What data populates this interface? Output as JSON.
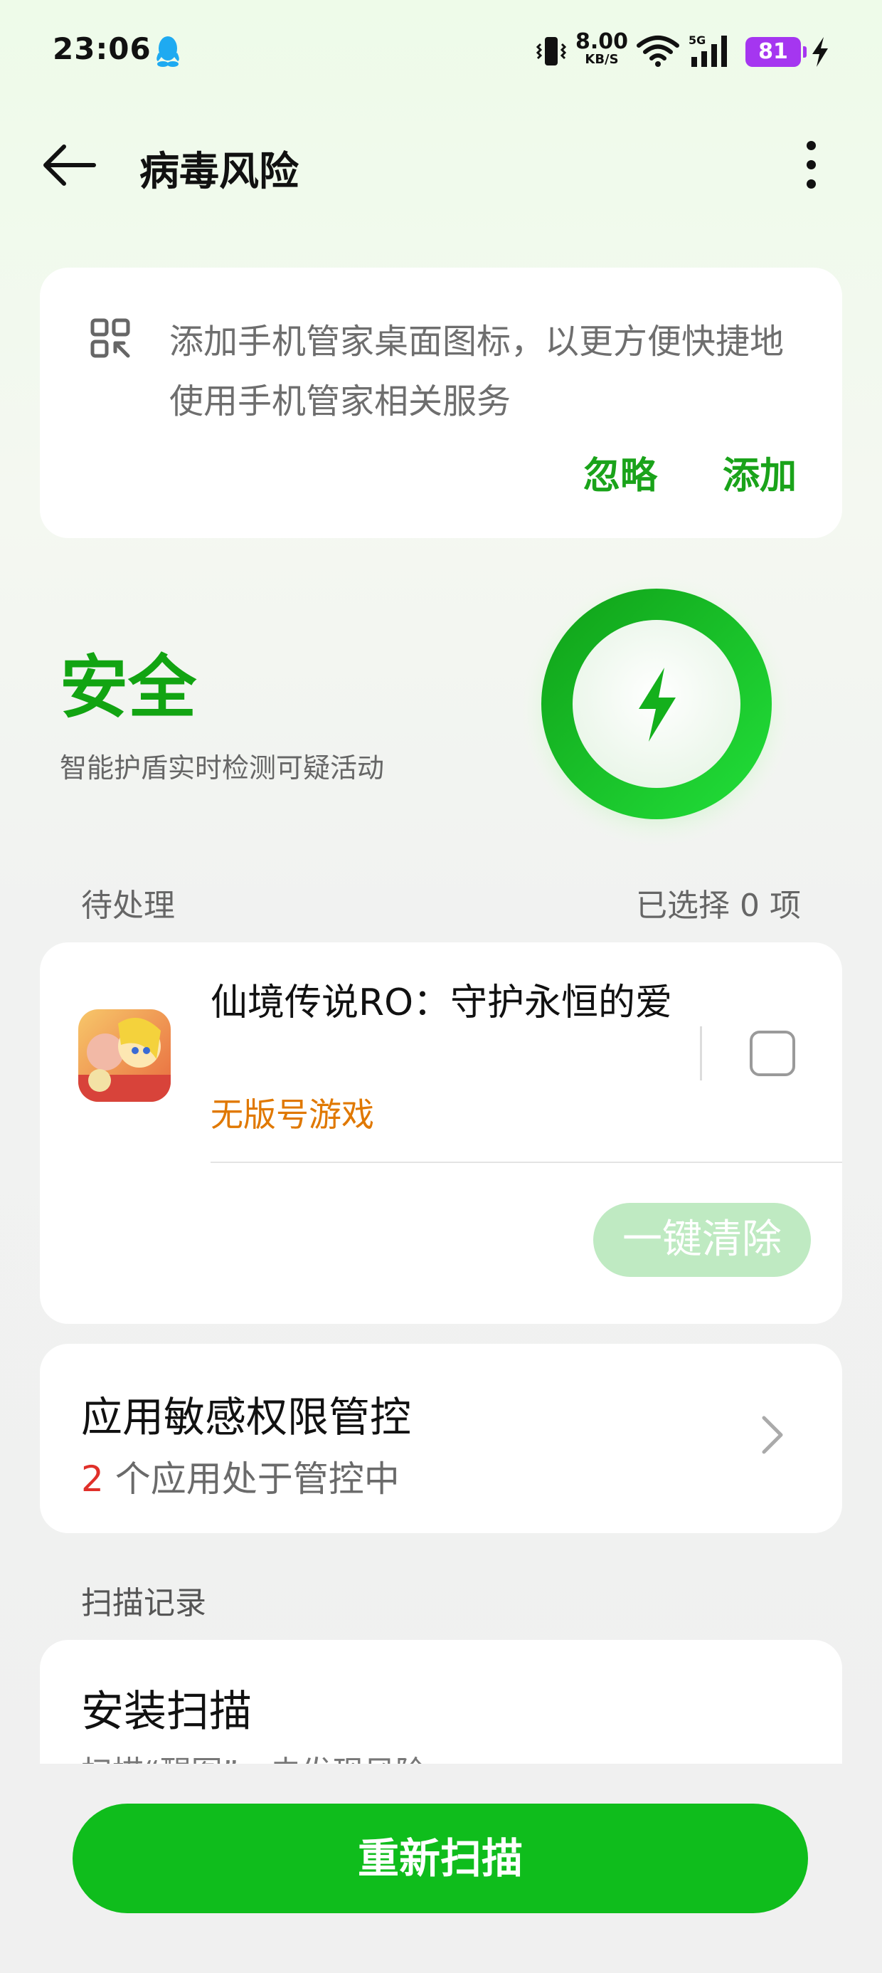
{
  "status_bar": {
    "time": "23:06",
    "net_speed_value": "8.00",
    "net_speed_unit": "KB/S",
    "battery_level": "81",
    "icons": [
      "qq-icon",
      "vibrate-icon",
      "wifi-icon",
      "signal-5g-icon",
      "charging-icon"
    ],
    "battery_color": "#a536f0"
  },
  "header": {
    "title": "病毒风险",
    "back_icon": "back-arrow-icon",
    "more_icon": "more-vertical-icon"
  },
  "promo": {
    "text": "添加手机管家桌面图标，以更方便快捷地使用手机管家相关服务",
    "ignore_label": "忽略",
    "add_label": "添加",
    "icon": "shortcut-icon"
  },
  "security_status": {
    "title": "安全",
    "subtitle": "智能护盾实时检测可疑活动",
    "ring_icon": "lightning-icon",
    "accent_color": "#12a412"
  },
  "pending": {
    "label": "待处理",
    "selected_text": "已选择 0 项",
    "items": [
      {
        "name": "仙境传说RO：守护永恒的爱",
        "tag": "无版号游戏",
        "checked": false
      }
    ],
    "clear_label": "一键清除"
  },
  "permission_control": {
    "title": "应用敏感权限管控",
    "count": "2",
    "subtitle_rest": " 个应用处于管控中"
  },
  "scan_records": {
    "label": "扫描记录",
    "items": [
      {
        "title": "安装扫描",
        "subtitle": "扫描“醒图”，未发现风险"
      }
    ]
  },
  "rescan_label": "重新扫描",
  "colors": {
    "primary_green": "#0fbd1c",
    "tag_orange": "#e07800",
    "count_red": "#e0302a"
  }
}
